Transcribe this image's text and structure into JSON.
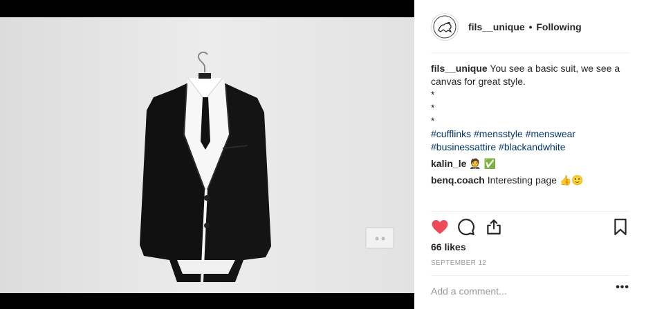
{
  "post": {
    "username": "fils__unique",
    "separator": "•",
    "follow_status": "Following",
    "caption": {
      "username": "fils__unique",
      "text": "You see a basic suit, we see a canvas for great style.",
      "bullets": [
        "*",
        "*",
        "*"
      ],
      "hashtags_line1": "#cufflinks #mensstyle #menswear",
      "hashtags_line2": "#businessattire #blackandwhite"
    },
    "comments": [
      {
        "username": "kalin_le",
        "text": "🤵 ✅"
      },
      {
        "username": "benq.coach",
        "text": "Interesting page 👍🙂"
      }
    ],
    "likes": "66 likes",
    "date": "SEPTEMBER 12",
    "comment_placeholder": "Add a comment...",
    "more_options": "•••"
  },
  "icons": {
    "like": "heart-filled-icon",
    "comment": "comment-bubble-icon",
    "share": "share-icon",
    "save": "bookmark-icon",
    "avatar": "lion-logo-icon"
  },
  "colors": {
    "like_red": "#ed4956",
    "hashtag_blue": "#003569",
    "muted_gray": "#999999",
    "divider": "#efefef"
  }
}
